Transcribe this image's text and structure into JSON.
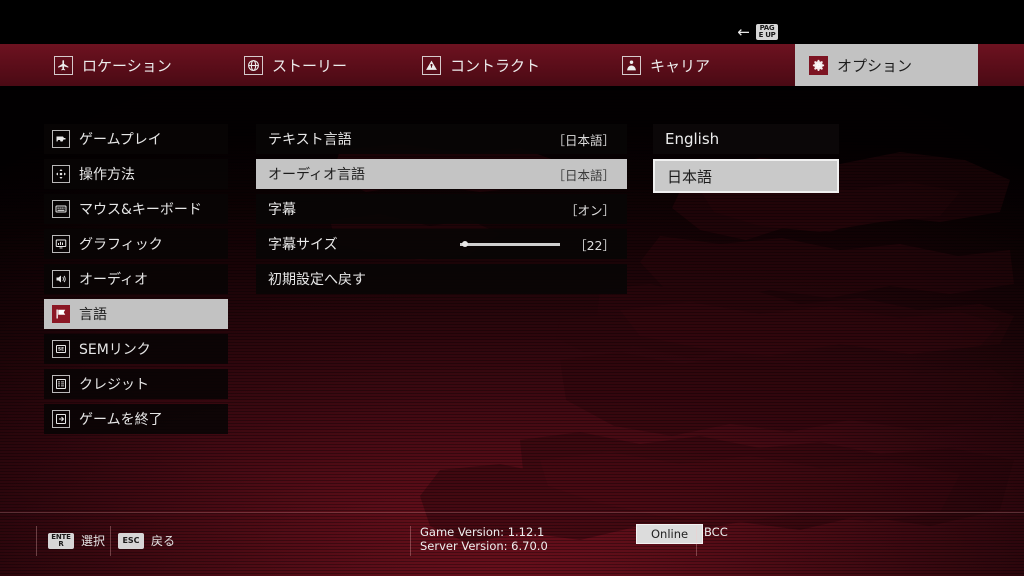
{
  "back_hint": {
    "arrow": "←",
    "key_line1": "PAG",
    "key_line2": "E UP",
    "name": "back"
  },
  "nav": {
    "tabs": [
      {
        "label": "ロケーション",
        "icon": "plane-icon",
        "active": false
      },
      {
        "label": "ストーリー",
        "icon": "globe-icon",
        "active": false
      },
      {
        "label": "コントラクト",
        "icon": "hazard-icon",
        "active": false
      },
      {
        "label": "キャリア",
        "icon": "person-icon",
        "active": false
      },
      {
        "label": "オプション",
        "icon": "gear-icon",
        "active": true
      }
    ]
  },
  "sidebar": {
    "items": [
      {
        "label": "ゲームプレイ",
        "icon": "gun-icon",
        "active": false
      },
      {
        "label": "操作方法",
        "icon": "dpad-icon",
        "active": false
      },
      {
        "label": "マウス&キーボード",
        "icon": "keyboard-icon",
        "active": false
      },
      {
        "label": "グラフィック",
        "icon": "monitor-icon",
        "active": false
      },
      {
        "label": "オーディオ",
        "icon": "speaker-icon",
        "active": false
      },
      {
        "label": "言語",
        "icon": "flag-icon",
        "active": true
      },
      {
        "label": "SEMリンク",
        "icon": "sem-icon",
        "active": false
      },
      {
        "label": "クレジット",
        "icon": "list-icon",
        "active": false
      },
      {
        "label": "ゲームを終了",
        "icon": "exit-icon",
        "active": false
      }
    ]
  },
  "settings": {
    "rows": [
      {
        "label": "テキスト言語",
        "value": "［日本語］",
        "type": "value",
        "active": false
      },
      {
        "label": "オーディオ言語",
        "value": "［日本語］",
        "type": "value",
        "active": true
      },
      {
        "label": "字幕",
        "value": "［オン］",
        "type": "value",
        "active": false
      },
      {
        "label": "字幕サイズ",
        "value": "［22］",
        "type": "slider",
        "slider_percent": 2,
        "active": false
      },
      {
        "label": "初期設定へ戻す",
        "value": "",
        "type": "action",
        "active": false
      }
    ]
  },
  "language_options": {
    "options": [
      {
        "label": "English",
        "active": false
      },
      {
        "label": "日本語",
        "active": true
      }
    ]
  },
  "bottom": {
    "hints": [
      {
        "key_line1": "ENTE",
        "key_line2": "R",
        "label": "選択",
        "name": "select"
      },
      {
        "key": "ESC",
        "label": "戻る",
        "name": "back"
      }
    ],
    "game_version": "Game Version: 1.12.1",
    "server_version": "Server Version: 6.70.0",
    "online_status": "Online",
    "build_tag": "BCC"
  },
  "colors": {
    "accent_red": "#6d1220",
    "highlight_gray": "#c2c2c2",
    "text_light": "#e8e8e8",
    "panel_dark": "#080506"
  }
}
